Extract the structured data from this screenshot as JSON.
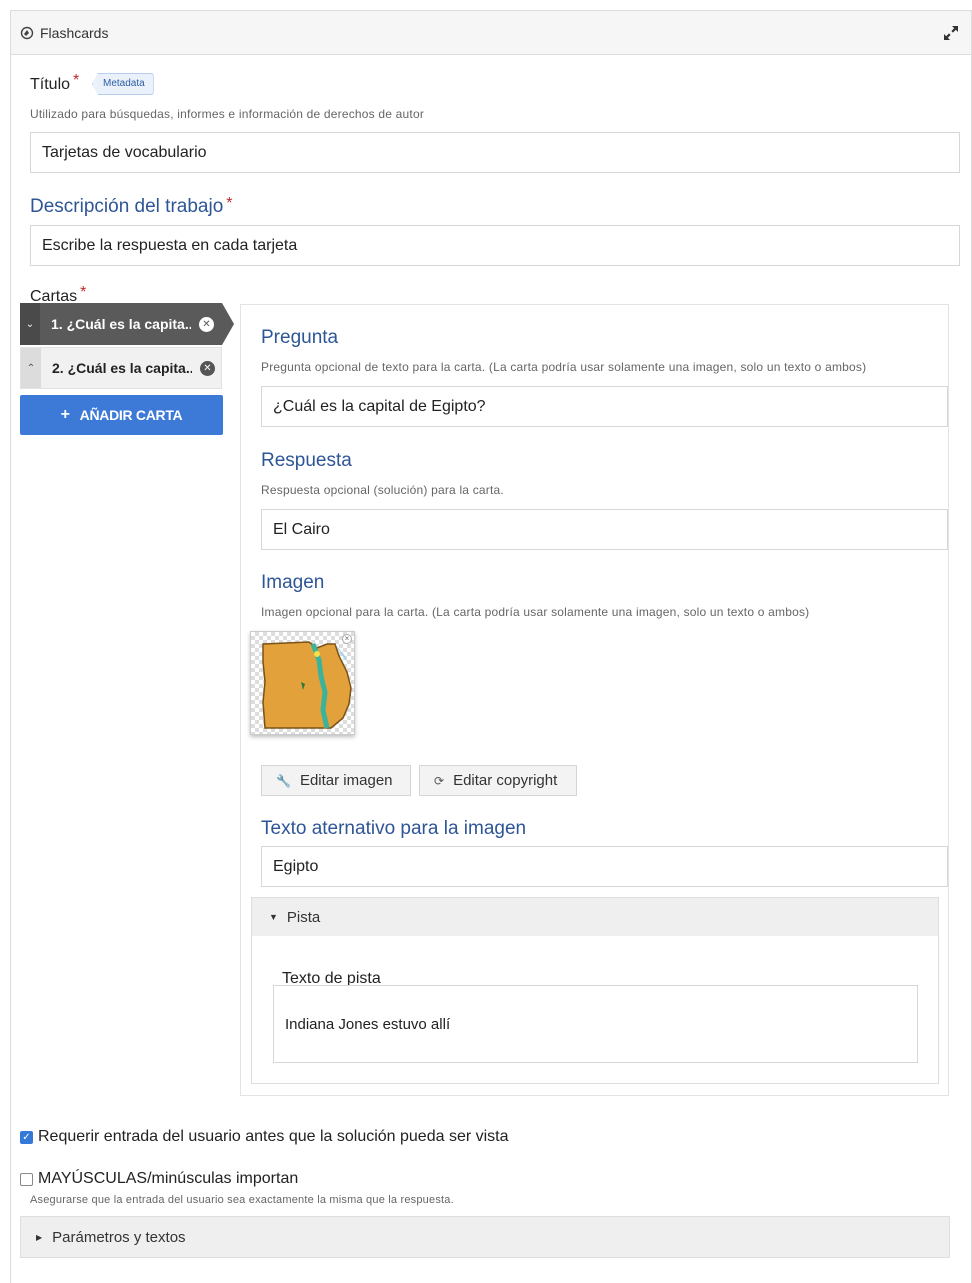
{
  "header": {
    "title": "Flashcards",
    "app_icon": "h5p-flashcards-icon",
    "expand_icon": "expand-arrows-icon"
  },
  "title_field": {
    "label": "Título",
    "required_mark": "*",
    "badge": "Metadata",
    "hint": "Utilizado para búsquedas, informes e información de derechos de autor",
    "value": "Tarjetas de vocabulario"
  },
  "description_field": {
    "label": "Descripción del trabajo",
    "required_mark": "*",
    "value": "Escribe la respuesta en cada tarjeta"
  },
  "cards": {
    "label": "Cartas",
    "required_mark": "*",
    "items": [
      {
        "label": "1. ¿Cuál es la capita...",
        "active": true
      },
      {
        "label": "2. ¿Cuál es la capita...",
        "active": false
      }
    ],
    "add_button": "AÑADIR CARTA"
  },
  "card_editor": {
    "question": {
      "heading": "Pregunta",
      "hint": "Pregunta opcional de texto para la carta. (La carta podría usar solamente una imagen, solo un texto o ambos)",
      "value": "¿Cuál es la capital de Egipto?"
    },
    "answer": {
      "heading": "Respuesta",
      "hint": "Respuesta opcional (solución) para la carta.",
      "value": "El Cairo"
    },
    "image": {
      "heading": "Imagen",
      "hint": "Imagen opcional para la carta. (La carta podría usar solamente una imagen, solo un texto o ambos)",
      "edit_image": "Editar imagen",
      "edit_copyright": "Editar copyright"
    },
    "alt_text": {
      "heading": "Texto aternativo para la imagen",
      "value": "Egipto"
    },
    "tip": {
      "toggle": "Pista",
      "label": "Texto de pista",
      "value": "Indiana Jones estuvo allí"
    }
  },
  "options": {
    "require_input": {
      "label": "Requerir entrada del usuario antes que la solución pueda ser vista",
      "checked": true
    },
    "case_sensitive": {
      "label": "MAYÚSCULAS/minúsculas importan",
      "checked": false,
      "hint": "Asegurarse que la entrada del usuario sea exactamente la misma que la respuesta."
    }
  },
  "settings": {
    "label": "Parámetros y textos"
  },
  "colors": {
    "accent": "#3d7ad8",
    "heading": "#2e5596",
    "required": "#c0282d",
    "map_land": "#e2a13a",
    "map_river": "#3bb39a"
  }
}
